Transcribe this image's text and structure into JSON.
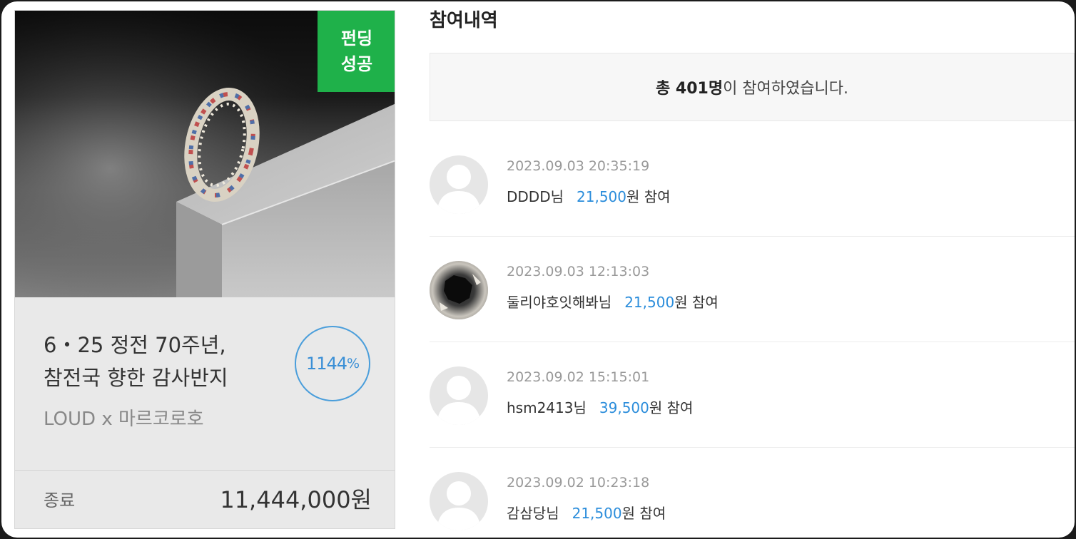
{
  "card": {
    "badge_line1": "펀딩",
    "badge_line2": "성공",
    "title_line1": "6・25 정전 70주년,",
    "title_line2": "참전국 향한 감사반지",
    "brand": "LOUD x 마르코로호",
    "rate_value": "1144",
    "rate_unit": "%",
    "status": "종료",
    "total": "11,444,000원",
    "badge_color": "#1fb14a",
    "accent_color": "#3a8fd6"
  },
  "panel": {
    "title": "참여내역",
    "summary_count": "총 401명",
    "summary_rest": "이 참여하였습니다."
  },
  "participants": [
    {
      "time": "2023.09.03 20:35:19",
      "name": "DDDD님",
      "amount": "21,500",
      "suffix": "원 참여",
      "avatar": "default"
    },
    {
      "time": "2023.09.03 12:13:03",
      "name": "둘리야호잇해봐님",
      "amount": "21,500",
      "suffix": "원 참여",
      "avatar": "photo"
    },
    {
      "time": "2023.09.02 15:15:01",
      "name": "hsm2413님",
      "amount": "39,500",
      "suffix": "원 참여",
      "avatar": "default"
    },
    {
      "time": "2023.09.02 10:23:18",
      "name": "감삼당님",
      "amount": "21,500",
      "suffix": "원 참여",
      "avatar": "default"
    }
  ],
  "icons": {
    "default_avatar": "person-silhouette-icon",
    "photo_avatar": "user-photo-avatar"
  }
}
